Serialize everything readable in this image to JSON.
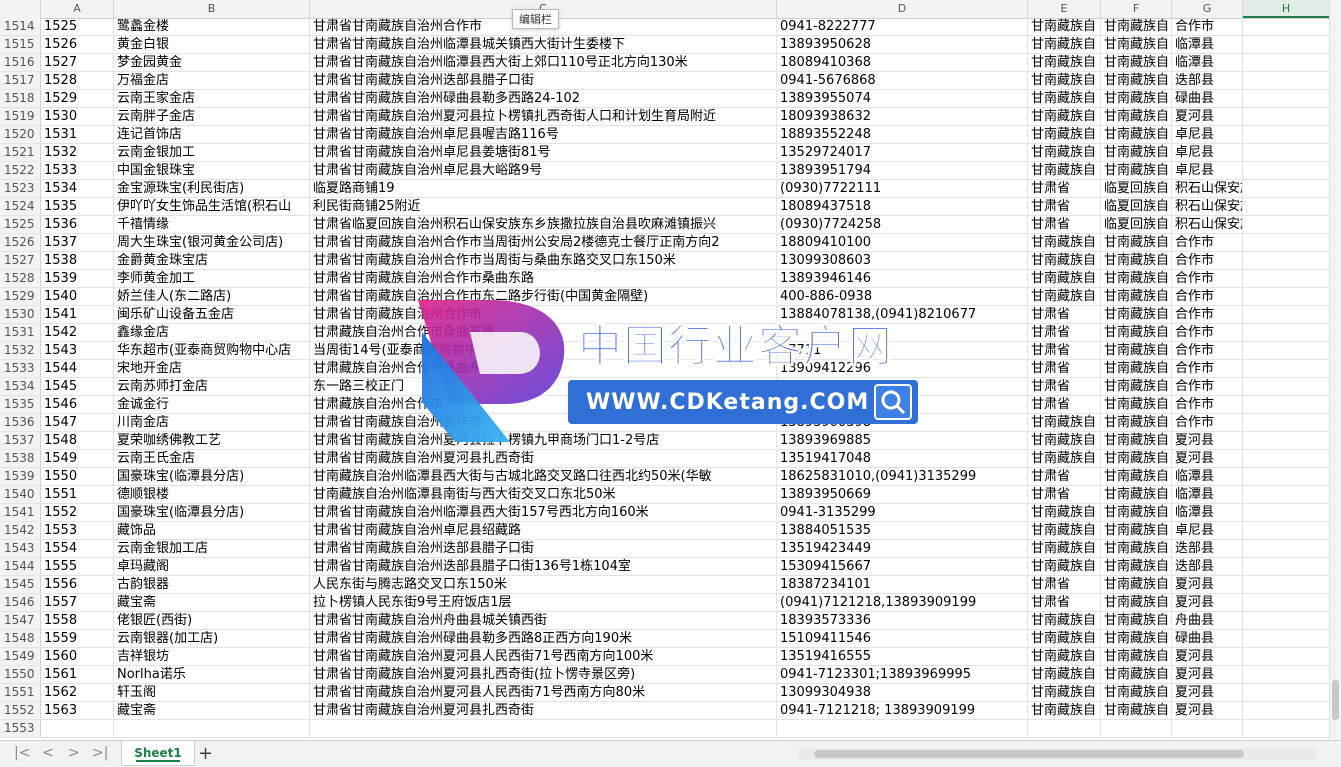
{
  "formula_tooltip": "编辑栏",
  "columns": [
    "A",
    "B",
    "C",
    "D",
    "E",
    "F",
    "G",
    "H"
  ],
  "active_column": "H",
  "rows": [
    {
      "n": "1514",
      "a": "1525",
      "b": "鹭蠡金楼",
      "c": "甘肃省甘南藏族自治州合作市",
      "d": "0941-8222777",
      "e": "甘南藏族自",
      "f": "甘南藏族自",
      "g": "合作市"
    },
    {
      "n": "1515",
      "a": "1526",
      "b": "黄金白银",
      "c": "甘肃省甘南藏族自治州临潭县城关镇西大街计生委楼下",
      "d": "13893950628",
      "e": "甘南藏族自",
      "f": "甘南藏族自",
      "g": "临潭县"
    },
    {
      "n": "1516",
      "a": "1527",
      "b": "梦金园黄金",
      "c": "甘肃省甘南藏族自治州临潭县西大街上郊口110号正北方向130米",
      "d": "18089410368",
      "e": "甘南藏族自",
      "f": "甘南藏族自",
      "g": "临潭县"
    },
    {
      "n": "1517",
      "a": "1528",
      "b": "万福金店",
      "c": "甘肃省甘南藏族自治州迭部县腊子口街",
      "d": "0941-5676868",
      "e": "甘南藏族自",
      "f": "甘南藏族自",
      "g": "迭部县"
    },
    {
      "n": "1518",
      "a": "1529",
      "b": "云南王家金店",
      "c": "甘肃省甘南藏族自治州碌曲县勒多西路24-102",
      "d": "13893955074",
      "e": "甘南藏族自",
      "f": "甘南藏族自",
      "g": "碌曲县"
    },
    {
      "n": "1519",
      "a": "1530",
      "b": "云南胖子金店",
      "c": "甘肃省甘南藏族自治州夏河县拉卜楞镇扎西奇街人口和计划生育局附近",
      "d": "18093938632",
      "e": "甘南藏族自",
      "f": "甘南藏族自",
      "g": "夏河县"
    },
    {
      "n": "1520",
      "a": "1531",
      "b": "连记首饰店",
      "c": "甘肃省甘南藏族自治州卓尼县喔吉路116号",
      "d": "18893552248",
      "e": "甘南藏族自",
      "f": "甘南藏族自",
      "g": "卓尼县"
    },
    {
      "n": "1521",
      "a": "1532",
      "b": "云南金银加工",
      "c": "甘肃省甘南藏族自治州卓尼县姜塘街81号",
      "d": "13529724017",
      "e": "甘南藏族自",
      "f": "甘南藏族自",
      "g": "卓尼县"
    },
    {
      "n": "1522",
      "a": "1533",
      "b": "中国金银珠宝",
      "c": "甘肃省甘南藏族自治州卓尼县大峪路9号",
      "d": "13893951794",
      "e": "甘南藏族自",
      "f": "甘南藏族自",
      "g": "卓尼县"
    },
    {
      "n": "1523",
      "a": "1534",
      "b": "金宝源珠宝(利民街店)",
      "c": "临夏路商铺19",
      "d": "(0930)7722111",
      "e": "甘肃省",
      "f": "临夏回族自",
      "g": "积石山保安族东乡族撒"
    },
    {
      "n": "1524",
      "a": "1535",
      "b": "伊吖吖女生饰品生活馆(积石山",
      "c": "利民街商铺25附近",
      "d": "18089437518",
      "e": "甘肃省",
      "f": "临夏回族自",
      "g": "积石山保安族东乡族撒"
    },
    {
      "n": "1525",
      "a": "1536",
      "b": "千禧情缘",
      "c": "甘肃省临夏回族自治州积石山保安族东乡族撒拉族自治县吹麻滩镇振兴",
      "d": "(0930)7724258",
      "e": "甘肃省",
      "f": "临夏回族自",
      "g": "积石山保安族东乡族撒"
    },
    {
      "n": "1526",
      "a": "1537",
      "b": "周大生珠宝(银河黄金公司店)",
      "c": "甘肃省甘南藏族自治州合作市当周街州公安局2楼德克士餐厅正南方向2",
      "d": "18809410100",
      "e": "甘南藏族自",
      "f": "甘南藏族自",
      "g": "合作市"
    },
    {
      "n": "1527",
      "a": "1538",
      "b": "金爵黄金珠宝店",
      "c": "甘肃省甘南藏族自治州合作市当周街与桑曲东路交叉口东150米",
      "d": "13099308603",
      "e": "甘南藏族自",
      "f": "甘南藏族自",
      "g": "合作市"
    },
    {
      "n": "1528",
      "a": "1539",
      "b": "李师黄金加工",
      "c": "甘肃省甘南藏族自治州合作市桑曲东路",
      "d": "13893946146",
      "e": "甘南藏族自",
      "f": "甘南藏族自",
      "g": "合作市"
    },
    {
      "n": "1529",
      "a": "1540",
      "b": "娇兰佳人(东二路店)",
      "c": "甘肃省甘南藏族自治州合作市东二路步行街(中国黄金隔壁)",
      "d": "400-886-0938",
      "e": "甘南藏族自",
      "f": "甘南藏族自",
      "g": "合作市"
    },
    {
      "n": "1530",
      "a": "1541",
      "b": "闽乐矿山设备五金店",
      "c": "甘肃省甘南藏族自治州合作市",
      "d": "13884078138,(0941)8210677",
      "e": "甘肃省",
      "f": "甘南藏族自",
      "g": "合作市"
    },
    {
      "n": "1531",
      "a": "1542",
      "b": "鑫缘金店",
      "c": "甘肃藏族自治州合作市桑曲东路",
      "d": "",
      "e": "甘肃省",
      "f": "甘南藏族自",
      "g": "合作市"
    },
    {
      "n": "1532",
      "a": "1543",
      "b": "华东超市(亚泰商贸购物中心店",
      "c": "当周街14号(亚泰商贸购物中心",
      "d": "17711",
      "e": "甘肃省",
      "f": "甘南藏族自",
      "g": "合作市"
    },
    {
      "n": "1533",
      "a": "1544",
      "b": "宋地开金店",
      "c": "甘肃藏族自治州合作市桑曲东路",
      "d": "13909412296",
      "e": "甘肃省",
      "f": "甘南藏族自",
      "g": "合作市"
    },
    {
      "n": "1534",
      "a": "1545",
      "b": "云南苏师打金店",
      "c": "东一路三校正门",
      "d": "17794125678",
      "e": "甘肃省",
      "f": "甘南藏族自",
      "g": "合作市"
    },
    {
      "n": "1535",
      "a": "1546",
      "b": "金诚金行",
      "c": "甘肃藏族自治州合作市",
      "d": "",
      "e": "甘肃省",
      "f": "甘南藏族自",
      "g": "合作市"
    },
    {
      "n": "1536",
      "a": "1547",
      "b": "川南金店",
      "c": "甘肃省甘南藏族自治州合作市",
      "d": "13893900398",
      "e": "甘南藏族自",
      "f": "甘南藏族自",
      "g": "合作市"
    },
    {
      "n": "1537",
      "a": "1548",
      "b": "夏荣咖绣佛教工艺",
      "c": "甘肃省甘南藏族自治州夏河县拉卜楞镇九甲商场门口1-2号店",
      "d": "13893969885",
      "e": "甘南藏族自",
      "f": "甘南藏族自",
      "g": "夏河县"
    },
    {
      "n": "1538",
      "a": "1549",
      "b": "云南王氏金店",
      "c": "甘肃省甘南藏族自治州夏河县扎西奇街",
      "d": "13519417048",
      "e": "甘南藏族自",
      "f": "甘南藏族自",
      "g": "夏河县"
    },
    {
      "n": "1539",
      "a": "1550",
      "b": "国豪珠宝(临潭县分店)",
      "c": "甘南藏族自治州临潭县西大街与古城北路交叉路口往西北约50米(华敏",
      "d": "18625831010,(0941)3135299",
      "e": "甘肃省",
      "f": "甘南藏族自",
      "g": "临潭县"
    },
    {
      "n": "1540",
      "a": "1551",
      "b": "德顺银楼",
      "c": "甘南藏族自治州临潭县南街与西大街交叉口东北50米",
      "d": "13893950669",
      "e": "甘肃省",
      "f": "甘南藏族自",
      "g": "临潭县"
    },
    {
      "n": "1541",
      "a": "1552",
      "b": "国豪珠宝(临潭县分店)",
      "c": "甘肃省甘南藏族自治州临潭县西大街157号西北方向160米",
      "d": "0941-3135299",
      "e": "甘南藏族自",
      "f": "甘南藏族自",
      "g": "临潭县"
    },
    {
      "n": "1542",
      "a": "1553",
      "b": "藏饰品",
      "c": "甘肃省甘南藏族自治州卓尼县绍藏路",
      "d": "13884051535",
      "e": "甘南藏族自",
      "f": "甘南藏族自",
      "g": "卓尼县"
    },
    {
      "n": "1543",
      "a": "1554",
      "b": "云南金银加工店",
      "c": "甘肃省甘南藏族自治州迭部县腊子口街",
      "d": "13519423449",
      "e": "甘南藏族自",
      "f": "甘南藏族自",
      "g": "迭部县"
    },
    {
      "n": "1544",
      "a": "1555",
      "b": "卓玛藏阁",
      "c": "甘肃省甘南藏族自治州迭部县腊子口街136号1栋104室",
      "d": "15309415667",
      "e": "甘南藏族自",
      "f": "甘南藏族自",
      "g": "迭部县"
    },
    {
      "n": "1545",
      "a": "1556",
      "b": "古韵银器",
      "c": "人民东街与腾志路交叉口东150米",
      "d": "18387234101",
      "e": "甘肃省",
      "f": "甘南藏族自",
      "g": "夏河县"
    },
    {
      "n": "1546",
      "a": "1557",
      "b": "藏宝斋",
      "c": "拉卜楞镇人民东街9号王府饭店1层",
      "d": "(0941)7121218,13893909199",
      "e": "甘肃省",
      "f": "甘南藏族自",
      "g": "夏河县"
    },
    {
      "n": "1547",
      "a": "1558",
      "b": "佬银匠(西街)",
      "c": "甘肃省甘南藏族自治州舟曲县城关镇西街",
      "d": "18393573336",
      "e": "甘南藏族自",
      "f": "甘南藏族自",
      "g": "舟曲县"
    },
    {
      "n": "1548",
      "a": "1559",
      "b": "云南银器(加工店)",
      "c": "甘肃省甘南藏族自治州碌曲县勒多西路8正西方向190米",
      "d": "15109411546",
      "e": "甘南藏族自",
      "f": "甘南藏族自",
      "g": "碌曲县"
    },
    {
      "n": "1549",
      "a": "1560",
      "b": "吉祥银坊",
      "c": "甘肃省甘南藏族自治州夏河县人民西街71号西南方向100米",
      "d": "13519416555",
      "e": "甘南藏族自",
      "f": "甘南藏族自",
      "g": "夏河县"
    },
    {
      "n": "1550",
      "a": "1561",
      "b": "Norlha诺乐",
      "c": "甘肃省甘南藏族自治州夏河县扎西奇街(拉卜愣寺景区旁)",
      "d": "0941-7123301;13893969995",
      "e": "甘南藏族自",
      "f": "甘南藏族自",
      "g": "夏河县"
    },
    {
      "n": "1551",
      "a": "1562",
      "b": "轩玉阁",
      "c": "甘肃省甘南藏族自治州夏河县人民西街71号西南方向80米",
      "d": "13099304938",
      "e": "甘南藏族自",
      "f": "甘南藏族自",
      "g": "夏河县"
    },
    {
      "n": "1552",
      "a": "1563",
      "b": "藏宝斋",
      "c": "甘肃省甘南藏族自治州夏河县扎西奇街",
      "d": "0941-7121218; 13893909199",
      "e": "甘南藏族自",
      "f": "甘南藏族自",
      "g": "夏河县"
    },
    {
      "n": "1553",
      "a": "",
      "b": "",
      "c": "",
      "d": "",
      "e": "",
      "f": "",
      "g": ""
    }
  ],
  "watermark": {
    "title": "中国行业客户网",
    "url": "WWW.CDKetang.COM",
    "title_color": "#4a6fe0",
    "bar_color": "#2f6fd6"
  },
  "tabbar": {
    "sheet_tab": "Sheet1",
    "add_label": "+",
    "nav": [
      "|<",
      "<",
      ">",
      ">|"
    ]
  },
  "accent_color": "#1d7f45"
}
